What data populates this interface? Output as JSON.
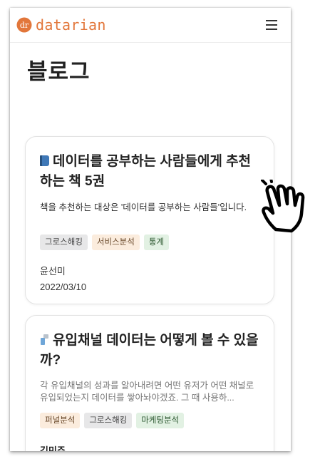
{
  "header": {
    "logo_text": "datarian",
    "logo_mark": "dr",
    "brand_color": "#e2763a",
    "menu_icon": "hamburger-icon"
  },
  "page": {
    "title": "블로그"
  },
  "posts": [
    {
      "icon": "blue-book-emoji",
      "title": "데이터를 공부하는 사람들에게 추천하는 책 5권",
      "description": "책을 추천하는 대상은 '데이터를 공부하는 사람들'입니다.",
      "tags": [
        "그로스해킹",
        "서비스분석",
        "통계"
      ],
      "author": "윤선미",
      "date": "2022/03/10"
    },
    {
      "icon": "faucet-emoji",
      "title": "유입채널 데이터는 어떻게 볼 수 있을까?",
      "description": "각 유입채널의 성과를 알아내려면 어떤 유저가 어떤 채널로 유입되었는지 데이터를 쌓아놔야겠죠. 그 때 사용하...",
      "tags": [
        "퍼널분석",
        "그로스해킹",
        "마케팅분석"
      ],
      "author": "김민주"
    }
  ],
  "cursor": {
    "icon": "pointing-hand-cursor"
  }
}
